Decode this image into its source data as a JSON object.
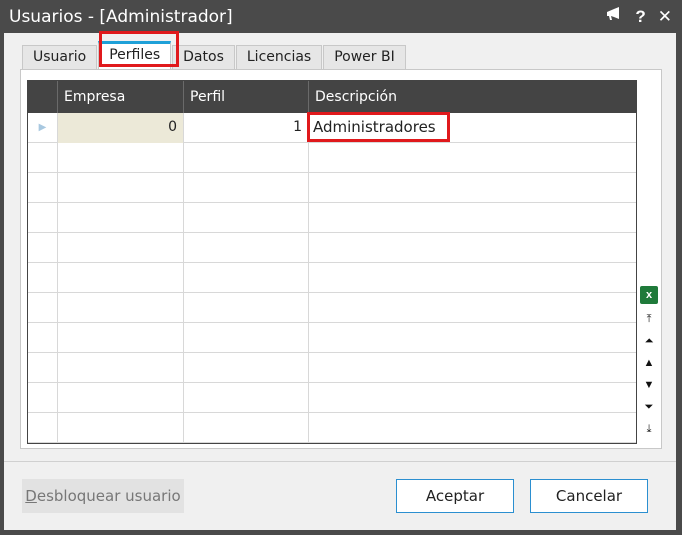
{
  "window": {
    "title": "Usuarios - [Administrador]",
    "icons": {
      "announce": "megaphone-icon",
      "help": "?",
      "close": "✕"
    }
  },
  "tabs": [
    "Usuario",
    "Perfiles",
    "Datos",
    "Licencias",
    "Power BI"
  ],
  "active_tab": "Perfiles",
  "grid": {
    "columns": [
      "Empresa",
      "Perfil",
      "Descripción"
    ],
    "rows": [
      {
        "empresa": "0",
        "perfil": "1",
        "descripcion": "Administradores"
      }
    ]
  },
  "side_tools": {
    "excel": "x",
    "nav": [
      "⤒",
      "⏶",
      "▲",
      "▼",
      "⏷",
      "⤓"
    ]
  },
  "buttons": {
    "unlock": "Desbloquear usuario",
    "accept": "Aceptar",
    "cancel": "Cancelar"
  },
  "colors": {
    "titlebar": "#4a4a4a",
    "tab_accent": "#1ea0d8",
    "highlight": "#e0191c",
    "button_border": "#2b8fd0"
  }
}
